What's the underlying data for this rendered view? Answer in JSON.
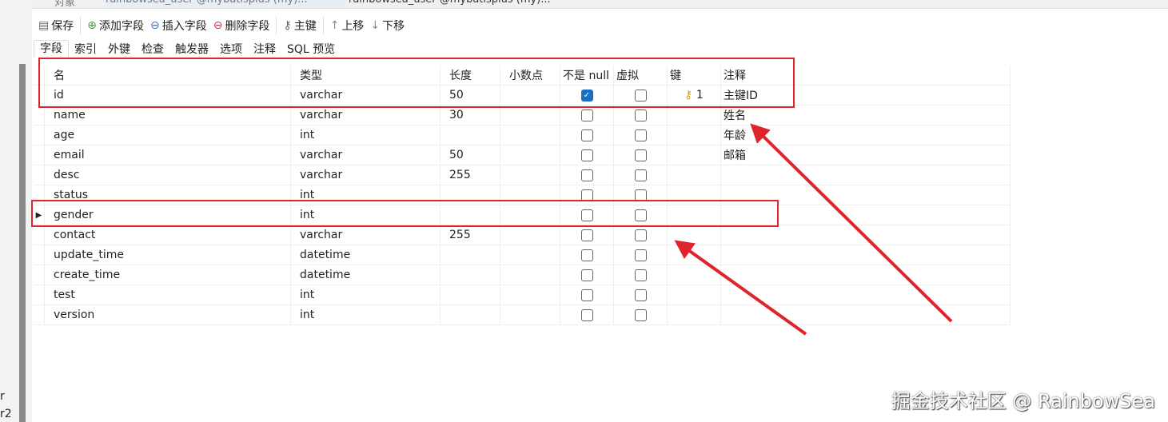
{
  "top_tabs": [
    "对象",
    "rainbowsea_user @mybatisplus (my)...",
    "rainbowsea_user @mybatisplus (my)..."
  ],
  "left_pane": [
    "r",
    "r2"
  ],
  "toolbar": {
    "save": "保存",
    "add_field": "添加字段",
    "insert_field": "插入字段",
    "delete_field": "删除字段",
    "primary_key": "主键",
    "move_up": "上移",
    "move_down": "下移"
  },
  "subtabs": [
    "字段",
    "索引",
    "外键",
    "检查",
    "触发器",
    "选项",
    "注释",
    "SQL 预览"
  ],
  "columns": [
    "名",
    "类型",
    "长度",
    "小数点",
    "不是 null",
    "虚拟",
    "键",
    "注释"
  ],
  "rows": [
    {
      "name": "id",
      "type": "varchar",
      "length": "50",
      "decimal": "",
      "not_null": true,
      "virtual": false,
      "key": "1",
      "comment": "主键ID"
    },
    {
      "name": "name",
      "type": "varchar",
      "length": "30",
      "decimal": "",
      "not_null": false,
      "virtual": false,
      "key": "",
      "comment": "姓名"
    },
    {
      "name": "age",
      "type": "int",
      "length": "",
      "decimal": "",
      "not_null": false,
      "virtual": false,
      "key": "",
      "comment": "年龄"
    },
    {
      "name": "email",
      "type": "varchar",
      "length": "50",
      "decimal": "",
      "not_null": false,
      "virtual": false,
      "key": "",
      "comment": "邮箱"
    },
    {
      "name": "desc",
      "type": "varchar",
      "length": "255",
      "decimal": "",
      "not_null": false,
      "virtual": false,
      "key": "",
      "comment": ""
    },
    {
      "name": "status",
      "type": "int",
      "length": "",
      "decimal": "",
      "not_null": false,
      "virtual": false,
      "key": "",
      "comment": ""
    },
    {
      "name": "gender",
      "type": "int",
      "length": "",
      "decimal": "",
      "not_null": false,
      "virtual": false,
      "key": "",
      "comment": ""
    },
    {
      "name": "contact",
      "type": "varchar",
      "length": "255",
      "decimal": "",
      "not_null": false,
      "virtual": false,
      "key": "",
      "comment": ""
    },
    {
      "name": "update_time",
      "type": "datetime",
      "length": "",
      "decimal": "",
      "not_null": false,
      "virtual": false,
      "key": "",
      "comment": ""
    },
    {
      "name": "create_time",
      "type": "datetime",
      "length": "",
      "decimal": "",
      "not_null": false,
      "virtual": false,
      "key": "",
      "comment": ""
    },
    {
      "name": "test",
      "type": "int",
      "length": "",
      "decimal": "",
      "not_null": false,
      "virtual": false,
      "key": "",
      "comment": ""
    },
    {
      "name": "version",
      "type": "int",
      "length": "",
      "decimal": "",
      "not_null": false,
      "virtual": false,
      "key": "",
      "comment": ""
    }
  ],
  "current_row": 6,
  "watermark": "掘金技术社区 @ RainbowSea",
  "colors": {
    "annotation": "#e0242b",
    "check": "#1a6fc2"
  }
}
